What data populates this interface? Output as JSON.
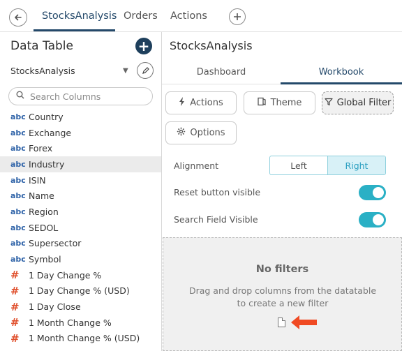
{
  "topbar": {
    "tabs": [
      {
        "label": "StocksAnalysis",
        "active": true
      },
      {
        "label": "Orders",
        "active": false
      },
      {
        "label": "Actions",
        "active": false
      }
    ],
    "back_icon": "back-arrow-icon",
    "add_icon": "plus-icon"
  },
  "left_panel": {
    "title": "Data Table",
    "datasource": "StocksAnalysis",
    "search_placeholder": "Search Columns",
    "columns": [
      {
        "type": "abc",
        "name": "Country"
      },
      {
        "type": "abc",
        "name": "Exchange"
      },
      {
        "type": "abc",
        "name": "Forex"
      },
      {
        "type": "abc",
        "name": "Industry",
        "selected": true
      },
      {
        "type": "abc",
        "name": "ISIN"
      },
      {
        "type": "abc",
        "name": "Name"
      },
      {
        "type": "abc",
        "name": "Region"
      },
      {
        "type": "abc",
        "name": "SEDOL"
      },
      {
        "type": "abc",
        "name": "Supersector"
      },
      {
        "type": "abc",
        "name": "Symbol"
      },
      {
        "type": "#",
        "name": "1 Day Change %"
      },
      {
        "type": "#",
        "name": "1 Day Change % (USD)"
      },
      {
        "type": "#",
        "name": "1 Day Close"
      },
      {
        "type": "#",
        "name": "1 Month Change %"
      },
      {
        "type": "#",
        "name": "1 Month Change % (USD)"
      }
    ]
  },
  "right_panel": {
    "title": "StocksAnalysis",
    "subtabs": [
      "Dashboard",
      "Workbook"
    ],
    "buttons": {
      "actions": "Actions",
      "theme": "Theme",
      "global_filter": "Global Filter",
      "options": "Options"
    },
    "alignment": {
      "label": "Alignment",
      "left": "Left",
      "right": "Right",
      "selected": "Right"
    },
    "reset_button_visible": {
      "label": "Reset button visible",
      "on": true
    },
    "search_field_visible": {
      "label": "Search Field Visible",
      "on": true
    },
    "dropzone": {
      "title": "No filters",
      "hint": "Drag and drop columns from the datatable to create a new filter"
    }
  },
  "colors": {
    "accent": "#24496a",
    "toggle_on": "#2ab0c5",
    "arrow": "#f04a23",
    "abc_type": "#2f63a8",
    "num_type": "#e0512e"
  }
}
